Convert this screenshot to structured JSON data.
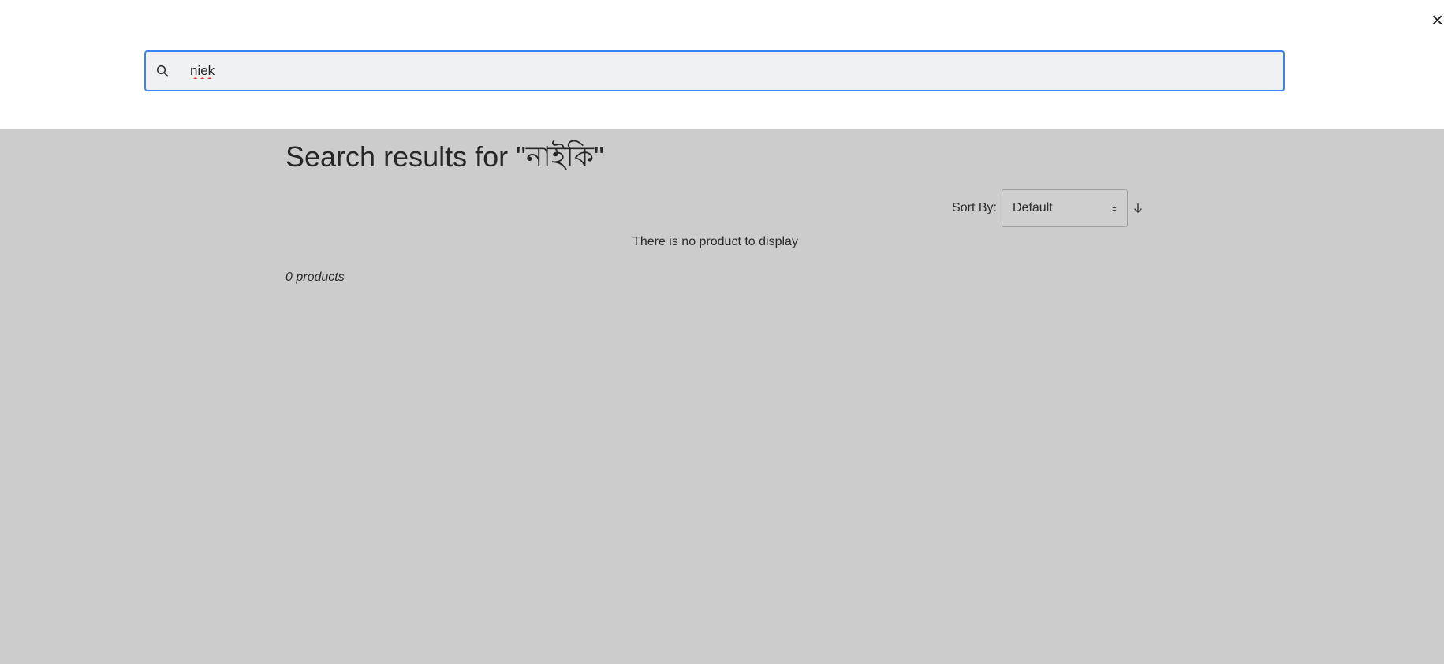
{
  "overlay": {
    "close_label": "×"
  },
  "search": {
    "value": "niek",
    "icon": "search-icon"
  },
  "results": {
    "title": "Search results for \"নাইকি\"",
    "sort_label": "Sort By:",
    "sort_selected": "Default",
    "sort_direction_icon": "arrow-down-icon",
    "empty_message": "There is no product to display",
    "count_text": "0 products"
  },
  "colors": {
    "overlay_background": "#ffffff",
    "page_background": "#cccccc",
    "search_border": "#3b82f6",
    "search_background": "#f0f1f3"
  }
}
